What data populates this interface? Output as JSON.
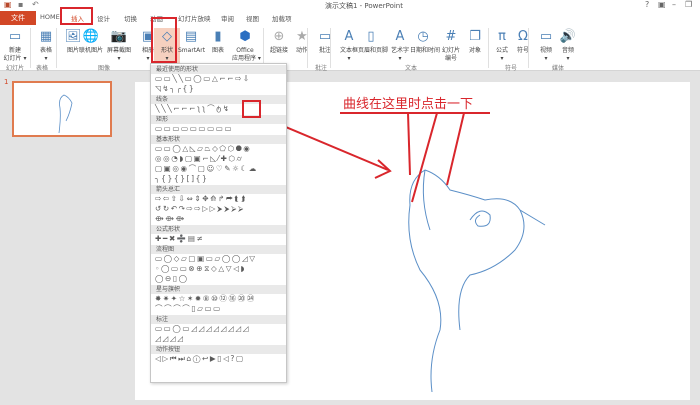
{
  "window": {
    "title": "演示文稿1 - PowerPoint",
    "help": "?",
    "minimize": "–",
    "restore": "❐"
  },
  "tabs": [
    "文件",
    "HOME",
    "插入",
    "设计",
    "切换",
    "动画",
    "幻灯片放映",
    "审阅",
    "视图",
    "加载项"
  ],
  "ribbon": {
    "buttons": [
      {
        "label": "新建\n幻灯片 ▾",
        "icon": "▭"
      },
      {
        "label": "表格\n▾",
        "icon": "▦"
      },
      {
        "label": "图片",
        "icon": "🖼"
      },
      {
        "label": "联机图片",
        "icon": "🌐"
      },
      {
        "label": "屏幕截图\n▾",
        "icon": "📷"
      },
      {
        "label": "相册\n▾",
        "icon": "▣"
      },
      {
        "label": "形状\n▾",
        "icon": "◇"
      },
      {
        "label": "SmartArt",
        "icon": "▤"
      },
      {
        "label": "图表",
        "icon": "▮"
      },
      {
        "label": "Office\n应用程序 ▾",
        "icon": "⬢"
      },
      {
        "label": "超链接",
        "icon": "⊕"
      },
      {
        "label": "动作",
        "icon": "★"
      },
      {
        "label": "批注",
        "icon": "▭"
      },
      {
        "label": "文本框\n▾",
        "icon": "A"
      },
      {
        "label": "页眉和页脚",
        "icon": "▯"
      },
      {
        "label": "艺术字\n▾",
        "icon": "A"
      },
      {
        "label": "日期和时间",
        "icon": "◷"
      },
      {
        "label": "幻灯片\n编号",
        "icon": "#"
      },
      {
        "label": "对象",
        "icon": "❐"
      },
      {
        "label": "公式\n▾",
        "icon": "π"
      },
      {
        "label": "符号",
        "icon": "Ω"
      },
      {
        "label": "视频\n▾",
        "icon": "▭"
      },
      {
        "label": "音频\n▾",
        "icon": "🔊"
      }
    ],
    "groups": [
      "幻灯片",
      "表格",
      "图像",
      "批注",
      "文本",
      "符号",
      "媒体"
    ]
  },
  "slide_number": "1",
  "shapes_menu": {
    "sections": [
      {
        "title": "最近使用的形状",
        "rows": [
          "▭▭╲╲▭◯▭△⌐⌐⇨⇩",
          "◹↯╮╭{}"
        ]
      },
      {
        "title": "线条",
        "rows": [
          "╲╲╲⌐⌐⌐ʅʅ⌒ტ↯"
        ]
      },
      {
        "title": "矩形",
        "rows": [
          "▭▭▭▭▭▭▭▭▭"
        ]
      },
      {
        "title": "基本形状",
        "rows": [
          "▭▭◯△◺▱⏢◇⬠⬡⯃◉",
          "◎◎◔◗▢▣⌐◺⁄✚⬡⌭",
          "▢▣◎◉⌒▢☺♡✎☼☾☁",
          "╮{}{}[]{}"
        ]
      },
      {
        "title": "箭头总汇",
        "rows": [
          "⇨⇦⇧⇩⇔⇕✥⟰↱⮫⮬⮭",
          "↺↻↶↷⇨⇨▷▷⮞⮞⮚⮚",
          "⟴⟴⟴"
        ]
      },
      {
        "title": "公式形状",
        "rows": [
          "✚━✖➗▤≠"
        ]
      },
      {
        "title": "流程图",
        "rows": [
          "▭◯◇▱▢▣▭▱◯◯◿▽",
          "◦◯▭▭⊗⊕⧖◇△▽◁◗",
          "◯⊖▯◯"
        ]
      },
      {
        "title": "星与旗帜",
        "rows": [
          "✸✷✦☆✶✹⑧⑩⑫⑯⑳㉔",
          "⌒⌒⌒⌒▯▱▭▭"
        ]
      },
      {
        "title": "标注",
        "rows": [
          "▭▭◯▭◿◿◿◿◿◿◿◿",
          "◿◿◿◿"
        ]
      },
      {
        "title": "动作按钮",
        "rows": [
          "◁▷⏮⏭⌂ⓘ↩▶▯◁?▢"
        ]
      }
    ]
  },
  "annotation": {
    "text": "曲线在这里时点击一下"
  },
  "colors": {
    "accent": "#d24726",
    "highlight": "#d9262c",
    "drawing": "#5b8fc7"
  }
}
